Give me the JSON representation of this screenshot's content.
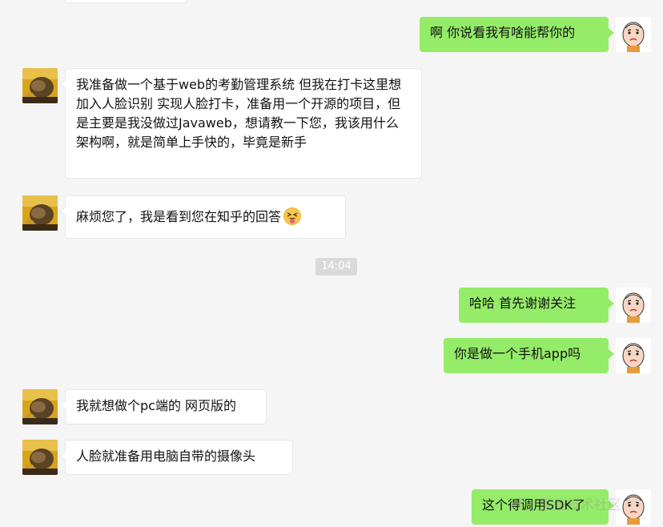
{
  "messages": [
    {
      "side": "out",
      "text": "啊  你说看我有啥能帮你的"
    },
    {
      "side": "in",
      "text": "我准备做一个基于web的考勤管理系统 但我在打卡这里想加入人脸识别 实现人脸打卡，准备用一个开源的项目，但是主要是我没做过Javaweb，想请教一下您，我该用什么架构啊，就是简单上手快的，毕竟是新手"
    },
    {
      "side": "in",
      "text": "麻烦您了，我是看到您在知乎的回答",
      "emoji": "squinting-tongue-emoji"
    },
    {
      "side": "out",
      "text": "哈哈 首先谢谢关注"
    },
    {
      "side": "out",
      "text": "你是做一个手机app吗"
    },
    {
      "side": "in",
      "text": "我就想做个pc端的 网页版的"
    },
    {
      "side": "in",
      "text": "人脸就准备用电脑自带的摄像头"
    },
    {
      "side": "out",
      "text": "这个得调用SDK了"
    }
  ],
  "timestamp": "14:04",
  "watermark": "稀土掘金技术社区",
  "colors": {
    "background": "#f5f5f5",
    "bubble_out": "#95ec69",
    "bubble_in": "#ffffff",
    "timestamp_bg": "#dadada"
  }
}
